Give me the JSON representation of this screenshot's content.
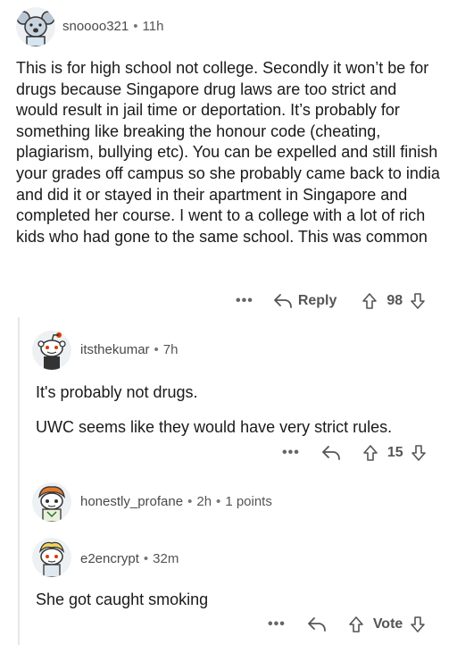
{
  "comments": [
    {
      "username": "snoooo321",
      "time": "11h",
      "body": "This is for high school not college. Secondly it won’t be for drugs because Singapore drug laws are too strict and would result in jail time or deportation. It’s probably for something like breaking the honour code (cheating, plagiarism, bullying etc). You can be expelled and still finish your grades off campus so she probably came back to india and did it or stayed in their apartment in Singapore and completed her course.  I went to a college with a lot of rich kids who had gone to the same school. This was common",
      "more": "•••",
      "reply_label": "Reply",
      "votes": "98"
    },
    {
      "username": "itsthekumar",
      "time": "7h",
      "body_lines": [
        "It's probably not drugs.",
        "UWC seems like they would have very strict rules."
      ],
      "more": "•••",
      "votes": "15"
    },
    {
      "username": "honestly_profane",
      "time": "2h",
      "points": "1 points"
    },
    {
      "username": "e2encrypt",
      "time": "32m",
      "body": "She got caught smoking",
      "more": "•••",
      "votes": "Vote"
    }
  ],
  "meta_separator": "•"
}
